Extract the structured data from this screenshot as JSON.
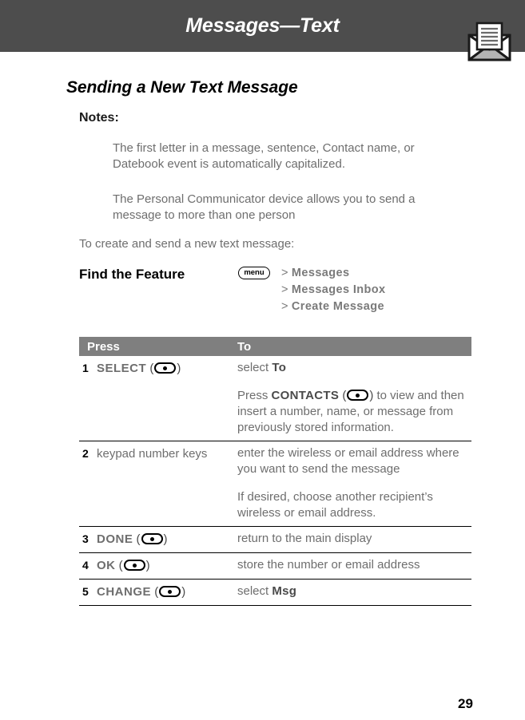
{
  "header": {
    "title": "Messages—Text",
    "icon": "envelope-document-icon",
    "bar_color": "#4d4d4d"
  },
  "section": {
    "heading": "Sending a New Text Message"
  },
  "notes": {
    "label": "Notes:",
    "items": [
      "The first letter in a message, sentence, Contact name, or Datebook event is automatically capitalized.",
      "The Personal Communicator device allows you to send a message to more than one person"
    ]
  },
  "intro": {
    "text": "To create and send a new text message:"
  },
  "find_the_feature": {
    "label": "Find the Feature",
    "menu_key_label": "menu",
    "steps": [
      {
        "arrow": ">",
        "label": "Messages"
      },
      {
        "arrow": ">",
        "label": "Messages Inbox"
      },
      {
        "arrow": ">",
        "label": "Create Message"
      }
    ]
  },
  "procedure_table": {
    "header": {
      "press": "Press",
      "to": "To"
    },
    "header_bg": "#7f7f7f",
    "rows": [
      {
        "num": "1",
        "press_softkey": "SELECT",
        "press_key_icon": "round-select-key-icon",
        "press_plain": "",
        "to_paragraphs": [
          {
            "pre": "select ",
            "emph": "To",
            "post": ""
          },
          {
            "pre": "Press ",
            "emph": "CONTACTS",
            "key_icon": "round-select-key-icon",
            "post": " to view and then insert a number, name, or message from previously stored information."
          }
        ]
      },
      {
        "num": "2",
        "press_softkey": "",
        "press_plain": "keypad number keys",
        "to_paragraphs": [
          {
            "pre": "enter the wireless or email address where you want to send the message",
            "emph": "",
            "post": ""
          },
          {
            "pre": "If desired, choose another recipient’s wireless or email address.",
            "emph": "",
            "post": ""
          }
        ]
      },
      {
        "num": "3",
        "press_softkey": "DONE",
        "press_key_icon": "round-select-key-icon",
        "press_plain": "",
        "to_paragraphs": [
          {
            "pre": "return to the main display",
            "emph": "",
            "post": ""
          }
        ]
      },
      {
        "num": "4",
        "press_softkey": "OK",
        "press_key_icon": "round-select-key-icon",
        "press_plain": "",
        "to_paragraphs": [
          {
            "pre": "store the number or email address",
            "emph": "",
            "post": ""
          }
        ]
      },
      {
        "num": "5",
        "press_softkey": "CHANGE",
        "press_key_icon": "round-select-key-icon",
        "press_plain": "",
        "to_paragraphs": [
          {
            "pre": "select ",
            "emph": "Msg",
            "post": ""
          }
        ]
      }
    ]
  },
  "footer": {
    "page_number": "29"
  }
}
